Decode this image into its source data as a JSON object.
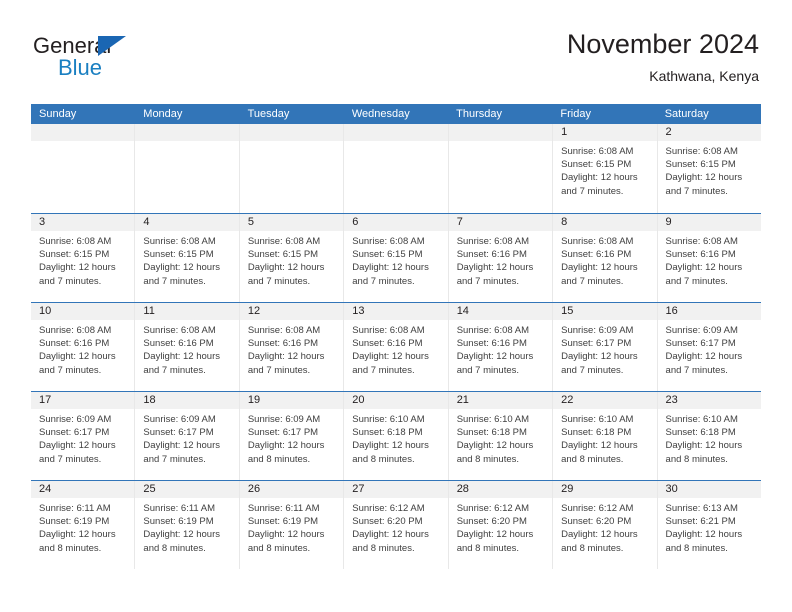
{
  "brand": {
    "name_top": "General",
    "name_bottom": "Blue",
    "triangle_color": "#1a66b3",
    "blue_text_color": "#1a7fc1"
  },
  "header": {
    "title": "November 2024",
    "subtitle": "Kathwana, Kenya",
    "accent_color": "#3275b8",
    "daynum_band_color": "#f1f1f1"
  },
  "weekdays": [
    "Sunday",
    "Monday",
    "Tuesday",
    "Wednesday",
    "Thursday",
    "Friday",
    "Saturday"
  ],
  "labels": {
    "sunrise_prefix": "Sunrise:",
    "sunset_prefix": "Sunset:",
    "daylight_prefix": "Daylight:"
  },
  "weeks": [
    [
      {
        "day": "",
        "empty": true
      },
      {
        "day": "",
        "empty": true
      },
      {
        "day": "",
        "empty": true
      },
      {
        "day": "",
        "empty": true
      },
      {
        "day": "",
        "empty": true
      },
      {
        "day": "1",
        "sunrise": "Sunrise: 6:08 AM",
        "sunset": "Sunset: 6:15 PM",
        "daylight1": "Daylight: 12 hours",
        "daylight2": "and 7 minutes."
      },
      {
        "day": "2",
        "sunrise": "Sunrise: 6:08 AM",
        "sunset": "Sunset: 6:15 PM",
        "daylight1": "Daylight: 12 hours",
        "daylight2": "and 7 minutes."
      }
    ],
    [
      {
        "day": "3",
        "sunrise": "Sunrise: 6:08 AM",
        "sunset": "Sunset: 6:15 PM",
        "daylight1": "Daylight: 12 hours",
        "daylight2": "and 7 minutes."
      },
      {
        "day": "4",
        "sunrise": "Sunrise: 6:08 AM",
        "sunset": "Sunset: 6:15 PM",
        "daylight1": "Daylight: 12 hours",
        "daylight2": "and 7 minutes."
      },
      {
        "day": "5",
        "sunrise": "Sunrise: 6:08 AM",
        "sunset": "Sunset: 6:15 PM",
        "daylight1": "Daylight: 12 hours",
        "daylight2": "and 7 minutes."
      },
      {
        "day": "6",
        "sunrise": "Sunrise: 6:08 AM",
        "sunset": "Sunset: 6:15 PM",
        "daylight1": "Daylight: 12 hours",
        "daylight2": "and 7 minutes."
      },
      {
        "day": "7",
        "sunrise": "Sunrise: 6:08 AM",
        "sunset": "Sunset: 6:16 PM",
        "daylight1": "Daylight: 12 hours",
        "daylight2": "and 7 minutes."
      },
      {
        "day": "8",
        "sunrise": "Sunrise: 6:08 AM",
        "sunset": "Sunset: 6:16 PM",
        "daylight1": "Daylight: 12 hours",
        "daylight2": "and 7 minutes."
      },
      {
        "day": "9",
        "sunrise": "Sunrise: 6:08 AM",
        "sunset": "Sunset: 6:16 PM",
        "daylight1": "Daylight: 12 hours",
        "daylight2": "and 7 minutes."
      }
    ],
    [
      {
        "day": "10",
        "sunrise": "Sunrise: 6:08 AM",
        "sunset": "Sunset: 6:16 PM",
        "daylight1": "Daylight: 12 hours",
        "daylight2": "and 7 minutes."
      },
      {
        "day": "11",
        "sunrise": "Sunrise: 6:08 AM",
        "sunset": "Sunset: 6:16 PM",
        "daylight1": "Daylight: 12 hours",
        "daylight2": "and 7 minutes."
      },
      {
        "day": "12",
        "sunrise": "Sunrise: 6:08 AM",
        "sunset": "Sunset: 6:16 PM",
        "daylight1": "Daylight: 12 hours",
        "daylight2": "and 7 minutes."
      },
      {
        "day": "13",
        "sunrise": "Sunrise: 6:08 AM",
        "sunset": "Sunset: 6:16 PM",
        "daylight1": "Daylight: 12 hours",
        "daylight2": "and 7 minutes."
      },
      {
        "day": "14",
        "sunrise": "Sunrise: 6:08 AM",
        "sunset": "Sunset: 6:16 PM",
        "daylight1": "Daylight: 12 hours",
        "daylight2": "and 7 minutes."
      },
      {
        "day": "15",
        "sunrise": "Sunrise: 6:09 AM",
        "sunset": "Sunset: 6:17 PM",
        "daylight1": "Daylight: 12 hours",
        "daylight2": "and 7 minutes."
      },
      {
        "day": "16",
        "sunrise": "Sunrise: 6:09 AM",
        "sunset": "Sunset: 6:17 PM",
        "daylight1": "Daylight: 12 hours",
        "daylight2": "and 7 minutes."
      }
    ],
    [
      {
        "day": "17",
        "sunrise": "Sunrise: 6:09 AM",
        "sunset": "Sunset: 6:17 PM",
        "daylight1": "Daylight: 12 hours",
        "daylight2": "and 7 minutes."
      },
      {
        "day": "18",
        "sunrise": "Sunrise: 6:09 AM",
        "sunset": "Sunset: 6:17 PM",
        "daylight1": "Daylight: 12 hours",
        "daylight2": "and 7 minutes."
      },
      {
        "day": "19",
        "sunrise": "Sunrise: 6:09 AM",
        "sunset": "Sunset: 6:17 PM",
        "daylight1": "Daylight: 12 hours",
        "daylight2": "and 8 minutes."
      },
      {
        "day": "20",
        "sunrise": "Sunrise: 6:10 AM",
        "sunset": "Sunset: 6:18 PM",
        "daylight1": "Daylight: 12 hours",
        "daylight2": "and 8 minutes."
      },
      {
        "day": "21",
        "sunrise": "Sunrise: 6:10 AM",
        "sunset": "Sunset: 6:18 PM",
        "daylight1": "Daylight: 12 hours",
        "daylight2": "and 8 minutes."
      },
      {
        "day": "22",
        "sunrise": "Sunrise: 6:10 AM",
        "sunset": "Sunset: 6:18 PM",
        "daylight1": "Daylight: 12 hours",
        "daylight2": "and 8 minutes."
      },
      {
        "day": "23",
        "sunrise": "Sunrise: 6:10 AM",
        "sunset": "Sunset: 6:18 PM",
        "daylight1": "Daylight: 12 hours",
        "daylight2": "and 8 minutes."
      }
    ],
    [
      {
        "day": "24",
        "sunrise": "Sunrise: 6:11 AM",
        "sunset": "Sunset: 6:19 PM",
        "daylight1": "Daylight: 12 hours",
        "daylight2": "and 8 minutes."
      },
      {
        "day": "25",
        "sunrise": "Sunrise: 6:11 AM",
        "sunset": "Sunset: 6:19 PM",
        "daylight1": "Daylight: 12 hours",
        "daylight2": "and 8 minutes."
      },
      {
        "day": "26",
        "sunrise": "Sunrise: 6:11 AM",
        "sunset": "Sunset: 6:19 PM",
        "daylight1": "Daylight: 12 hours",
        "daylight2": "and 8 minutes."
      },
      {
        "day": "27",
        "sunrise": "Sunrise: 6:12 AM",
        "sunset": "Sunset: 6:20 PM",
        "daylight1": "Daylight: 12 hours",
        "daylight2": "and 8 minutes."
      },
      {
        "day": "28",
        "sunrise": "Sunrise: 6:12 AM",
        "sunset": "Sunset: 6:20 PM",
        "daylight1": "Daylight: 12 hours",
        "daylight2": "and 8 minutes."
      },
      {
        "day": "29",
        "sunrise": "Sunrise: 6:12 AM",
        "sunset": "Sunset: 6:20 PM",
        "daylight1": "Daylight: 12 hours",
        "daylight2": "and 8 minutes."
      },
      {
        "day": "30",
        "sunrise": "Sunrise: 6:13 AM",
        "sunset": "Sunset: 6:21 PM",
        "daylight1": "Daylight: 12 hours",
        "daylight2": "and 8 minutes."
      }
    ]
  ]
}
